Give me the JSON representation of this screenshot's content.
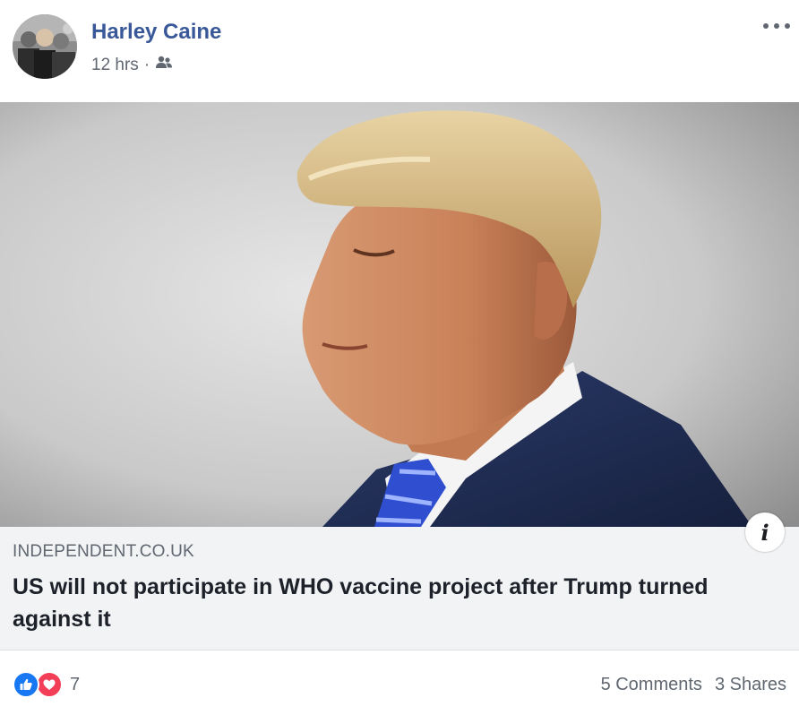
{
  "post": {
    "author": "Harley Caine",
    "time": "12 hrs",
    "separator": "·",
    "audience_icon": "friends-icon",
    "more_icon": "more-options-icon"
  },
  "link": {
    "domain": "INDEPENDENT.CO.UK",
    "title": "US will not participate in WHO vaccine project after Trump turned against it",
    "info_label": "i"
  },
  "footer": {
    "reaction_icons": [
      "like-icon",
      "love-icon"
    ],
    "reaction_count": "7",
    "comments": "5 Comments",
    "shares": "3 Shares"
  },
  "colors": {
    "author_link": "#385898",
    "like": "#1877f2",
    "love": "#f33e58",
    "link_bg": "#f2f3f5",
    "muted_text": "#606770"
  }
}
